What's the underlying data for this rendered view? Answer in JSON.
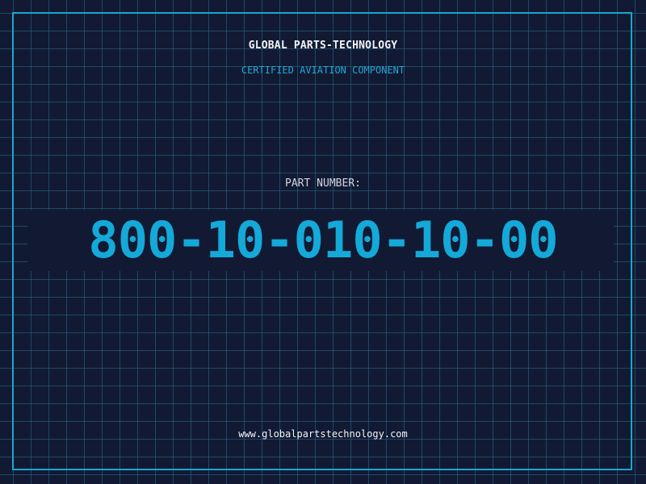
{
  "header": {
    "brand": "GLOBAL PARTS-TECHNOLOGY",
    "tagline": "CERTIFIED AVIATION COMPONENT"
  },
  "part": {
    "label": "PART NUMBER:",
    "number": "800-10-010-10-00"
  },
  "footer": {
    "url": "www.globalpartstechnology.com"
  },
  "colors": {
    "background": "#121a33",
    "grid": "#286e8c",
    "accent": "#14a9d8",
    "text": "#f2f4f8"
  }
}
